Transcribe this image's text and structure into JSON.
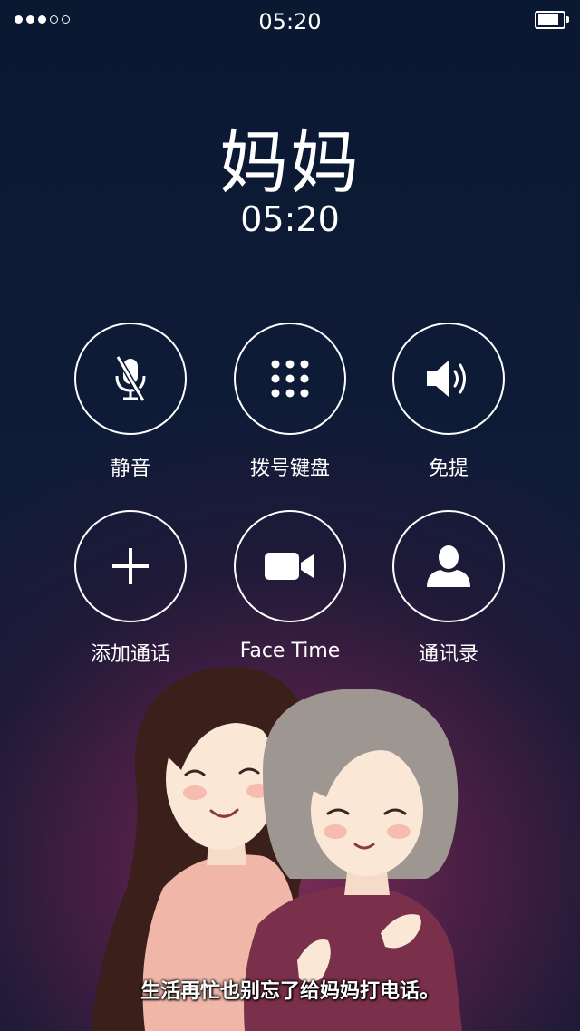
{
  "status_bar": {
    "time": "05:20",
    "signal_dots_filled": 3,
    "signal_dots_total": 5
  },
  "call": {
    "contact_name": "妈妈",
    "duration": "05:20"
  },
  "buttons": {
    "mute": {
      "label": "静音",
      "icon": "mic-off-icon"
    },
    "keypad": {
      "label": "拨号键盘",
      "icon": "keypad-icon"
    },
    "speaker": {
      "label": "免提",
      "icon": "speaker-icon"
    },
    "add_call": {
      "label": "添加通话",
      "icon": "plus-icon"
    },
    "facetime": {
      "label": "Face Time",
      "icon": "video-camera-icon"
    },
    "contacts": {
      "label": "通讯录",
      "icon": "person-icon"
    }
  },
  "caption": "生活再忙也别忘了给妈妈打电话。"
}
